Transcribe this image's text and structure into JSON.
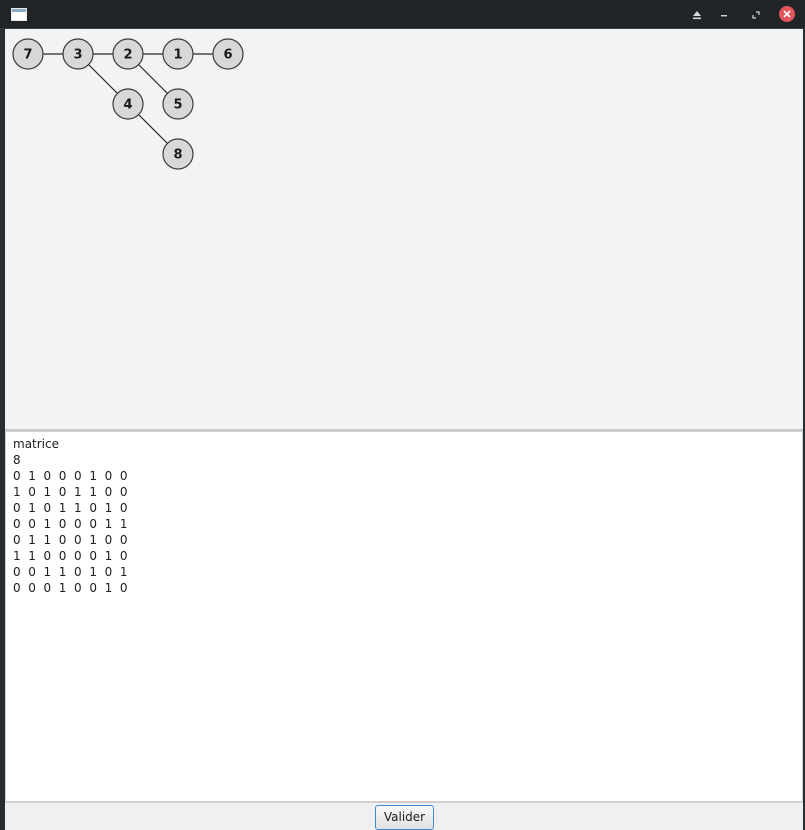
{
  "window": {
    "title": "",
    "icons": {
      "app": "window-icon",
      "eject": "eject-icon",
      "minimize": "minimize-icon",
      "maximize": "maximize-icon",
      "close": "close-icon"
    },
    "close_color": "#e0565b"
  },
  "graph": {
    "nodes": [
      {
        "id": "7",
        "label": "7"
      },
      {
        "id": "3",
        "label": "3"
      },
      {
        "id": "2",
        "label": "2"
      },
      {
        "id": "1",
        "label": "1"
      },
      {
        "id": "6",
        "label": "6"
      },
      {
        "id": "4",
        "label": "4"
      },
      {
        "id": "5",
        "label": "5"
      },
      {
        "id": "8",
        "label": "8"
      }
    ],
    "edges": [
      [
        "7",
        "3"
      ],
      [
        "3",
        "2"
      ],
      [
        "2",
        "1"
      ],
      [
        "1",
        "6"
      ],
      [
        "3",
        "4"
      ],
      [
        "2",
        "5"
      ],
      [
        "4",
        "8"
      ]
    ]
  },
  "text_area": {
    "lines": [
      "matrice",
      "8",
      "0  1  0  0  0  1  0  0",
      "1  0  1  0  1  1  0  0",
      "0  1  0  1  1  0  1  0",
      "0  0  1  0  0  0  1  1",
      "0  1  1  0  0  1  0  0",
      "1  1  0  0  0  0  1  0",
      "0  0  1  1  0  1  0  1",
      "0  0  0  1  0  0  1  0"
    ]
  },
  "buttons": {
    "valider": "Valider"
  }
}
